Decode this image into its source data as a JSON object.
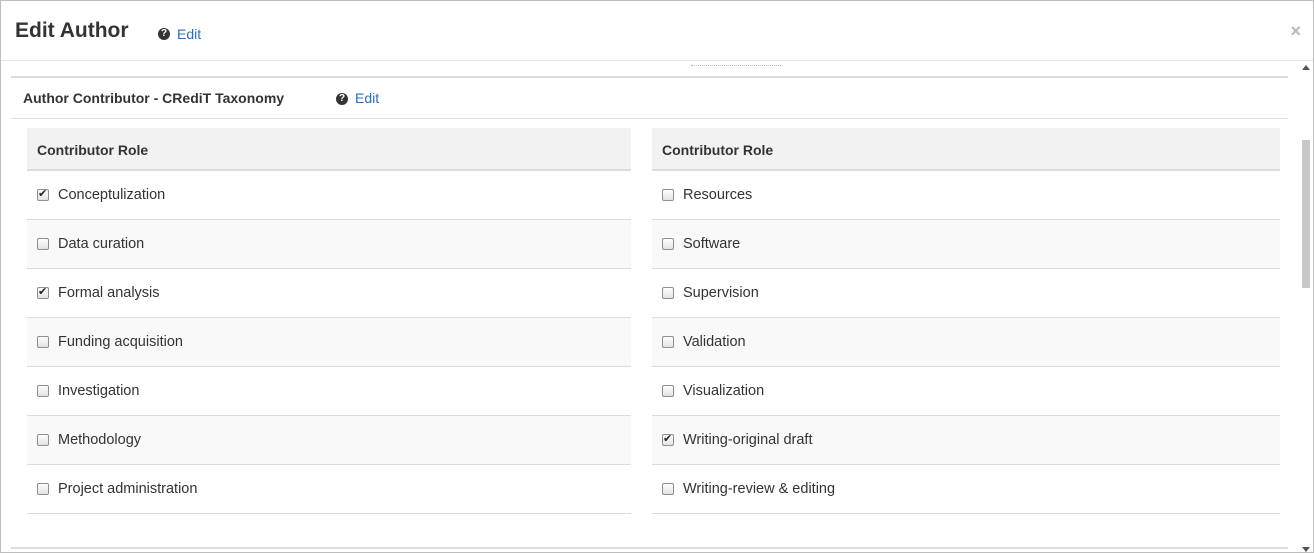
{
  "header": {
    "title": "Edit Author",
    "help_glyph": "?",
    "edit_label": "Edit",
    "close_glyph": "×"
  },
  "section": {
    "title": "Author Contributor - CRediT Taxonomy",
    "help_glyph": "?",
    "edit_label": "Edit"
  },
  "left_table": {
    "header": "Contributor Role",
    "rows": [
      {
        "label": "Conceptulization",
        "checked": true
      },
      {
        "label": "Data curation",
        "checked": false
      },
      {
        "label": "Formal analysis",
        "checked": true
      },
      {
        "label": "Funding acquisition",
        "checked": false
      },
      {
        "label": "Investigation",
        "checked": false
      },
      {
        "label": "Methodology",
        "checked": false
      },
      {
        "label": "Project administration",
        "checked": false
      }
    ]
  },
  "right_table": {
    "header": "Contributor Role",
    "rows": [
      {
        "label": "Resources",
        "checked": false
      },
      {
        "label": "Software",
        "checked": false
      },
      {
        "label": "Supervision",
        "checked": false
      },
      {
        "label": "Validation",
        "checked": false
      },
      {
        "label": "Visualization",
        "checked": false
      },
      {
        "label": "Writing-original draft",
        "checked": true
      },
      {
        "label": "Writing-review & editing",
        "checked": false
      }
    ]
  },
  "colors": {
    "link": "#2a6ebb",
    "header_bg": "#f2f2f2",
    "rule": "#dcdcdc"
  }
}
